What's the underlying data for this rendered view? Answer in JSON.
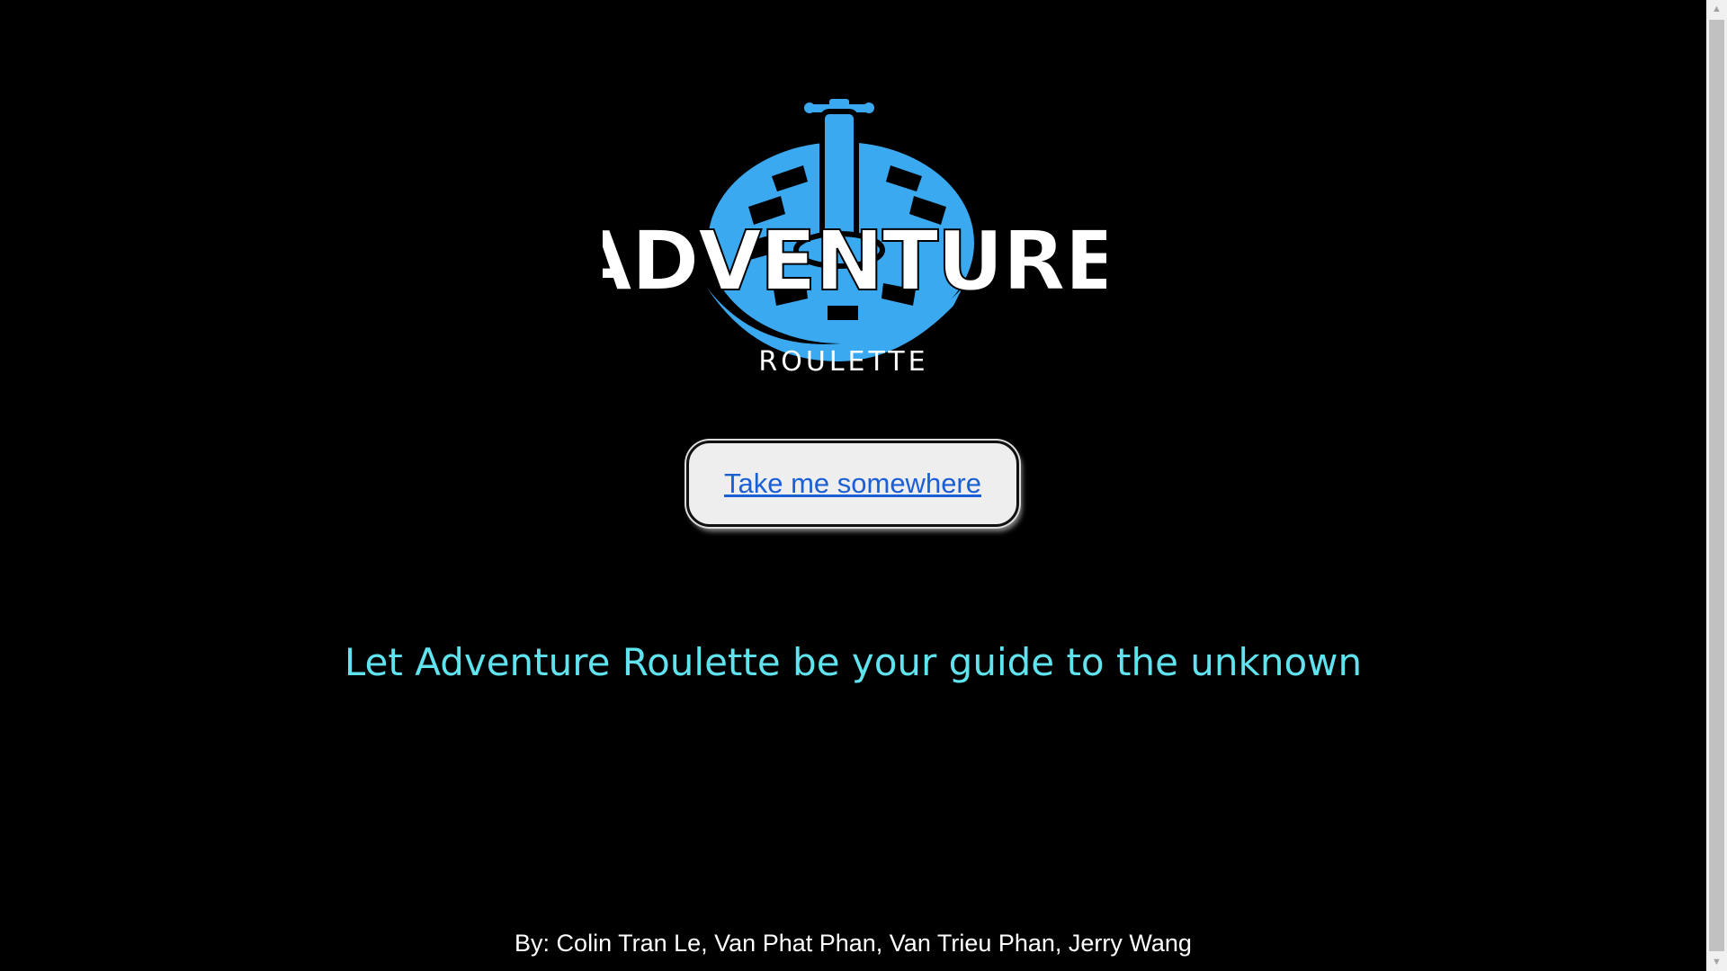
{
  "logo": {
    "wordmark": "ADVENTURE",
    "subtitle": "ROULETTE",
    "wheel_color": "#3aa9f0",
    "text_color": "#ffffff"
  },
  "cta": {
    "label": "Take me somewhere"
  },
  "tagline": "Let Adventure Roulette be your guide to the unknown",
  "credits": "By: Colin Tran Le, Van Phat Phan, Van Trieu Phan, Jerry Wang",
  "scrollbar": {
    "up_icon": "scroll-up-arrow",
    "down_icon": "scroll-down-arrow"
  }
}
